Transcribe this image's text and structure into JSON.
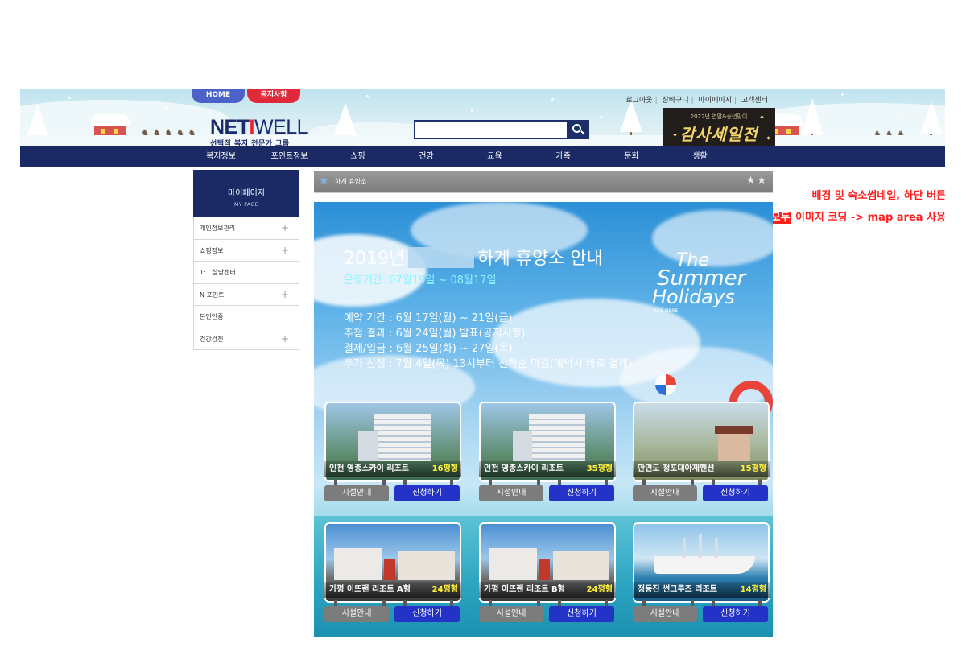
{
  "header": {
    "tabs": [
      "HOME",
      "공지사항"
    ],
    "util_links": [
      "로그아웃",
      "장바구니",
      "마이페이지",
      "고객센터"
    ],
    "logo": {
      "name_neti": "NET",
      "name_i": "I",
      "name_well": "WELL",
      "tagline": "선택적 복지 전문가 그룹"
    },
    "search": {
      "value": "",
      "placeholder": ""
    },
    "promo": {
      "subtitle": "2022년 연말&송년맞이",
      "title": "감사세일전"
    },
    "gnb": [
      "복지정보",
      "포인트정보",
      "쇼핑",
      "건강",
      "교육",
      "가족",
      "문화",
      "생활"
    ]
  },
  "sidebar": {
    "title": "마이페이지",
    "subtitle": "MY PAGE",
    "items": [
      {
        "label": "개인정보관리",
        "expandable": true
      },
      {
        "label": "쇼핑정보",
        "expandable": true
      },
      {
        "label": "1:1 상담센터",
        "expandable": false
      },
      {
        "label": "N 포인트",
        "expandable": true
      },
      {
        "label": "본인인증",
        "expandable": false
      },
      {
        "label": "건강검진",
        "expandable": true
      }
    ]
  },
  "breadcrumb": {
    "label": "하계 휴양소"
  },
  "annotation": {
    "line1": "배경 및 숙소썸네일, 하단 버튼",
    "line2_boxed": "모두",
    "line2_rest": " 이미지 코딩 -> map area 사용"
  },
  "banner": {
    "title_year": "2019년",
    "title_rest": "하계 휴양소 안내",
    "period": "운영기간: 07월19일 ~ 08월17일",
    "info": [
      "예약 기간 : 6월 17일(월) ~ 21일(금)",
      "추첨 결과 : 6월 24일(월) 발표(공지사항)",
      "결제/입금 : 6월 25일(화) ~ 27일(목)",
      "추가 신청 : 7월 4일(목) 13시부터 선착순 마감(예약시 바로 결제)"
    ],
    "summer_logo": {
      "line1": "The",
      "line2": "Summer",
      "line3": "Holidays",
      "line4": "ARE HERE"
    }
  },
  "resorts": [
    {
      "name": "인천 영종스카이 리조트",
      "size": "16평형",
      "info_btn": "시설안내",
      "apply_btn": "신청하기"
    },
    {
      "name": "인천 영종스카이 리조트",
      "size": "35평형",
      "info_btn": "시설안내",
      "apply_btn": "신청하기"
    },
    {
      "name": "안면도 청포대아재펜션",
      "size": "15평형",
      "info_btn": "시설안내",
      "apply_btn": "신청하기"
    },
    {
      "name": "가평 이뜨랜 리조트 A형",
      "size": "24평형",
      "info_btn": "시설안내",
      "apply_btn": "신청하기"
    },
    {
      "name": "가평 이뜨랜 리조트 B형",
      "size": "24평형",
      "info_btn": "시설안내",
      "apply_btn": "신청하기"
    },
    {
      "name": "정동진 썬크루즈 리조트",
      "size": "14평형",
      "info_btn": "시설안내",
      "apply_btn": "신청하기"
    }
  ],
  "colors": {
    "navy": "#1b2a64",
    "accent_red": "#e02a3a",
    "apply_blue": "#2333c8",
    "size_yellow": "#fff33a"
  }
}
